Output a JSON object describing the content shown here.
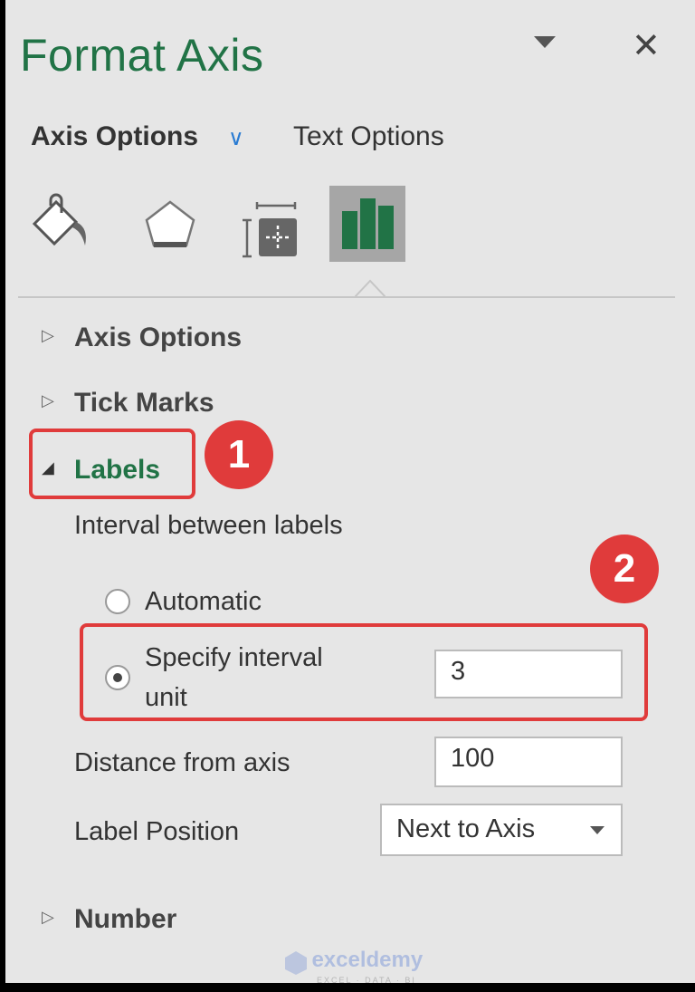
{
  "header": {
    "title": "Format Axis",
    "dropdown_icon": "caret-down-icon",
    "close_icon": "close-icon",
    "close_glyph": "✕"
  },
  "tabs": {
    "axis_options": "Axis Options",
    "text_options": "Text Options"
  },
  "icon_tabs": [
    "fill-line-icon",
    "effects-icon",
    "size-properties-icon",
    "axis-options-icon"
  ],
  "sections": {
    "axis_options": "Axis Options",
    "tick_marks": "Tick Marks",
    "labels": "Labels",
    "number": "Number"
  },
  "labels": {
    "interval_heading": "Interval between labels",
    "automatic": "Automatic",
    "specify_line1": "Specify interval",
    "specify_line2": "unit",
    "interval_value": "3",
    "selected": "specify",
    "distance_label": "Distance from axis",
    "distance_value": "100",
    "position_label": "Label Position",
    "position_value": "Next to Axis"
  },
  "annotations": {
    "step1": "1",
    "step2": "2",
    "color": "#e03b3b"
  },
  "accent_color": "#217346",
  "watermark": {
    "brand": "exceldemy",
    "tagline": "EXCEL · DATA · BI"
  }
}
